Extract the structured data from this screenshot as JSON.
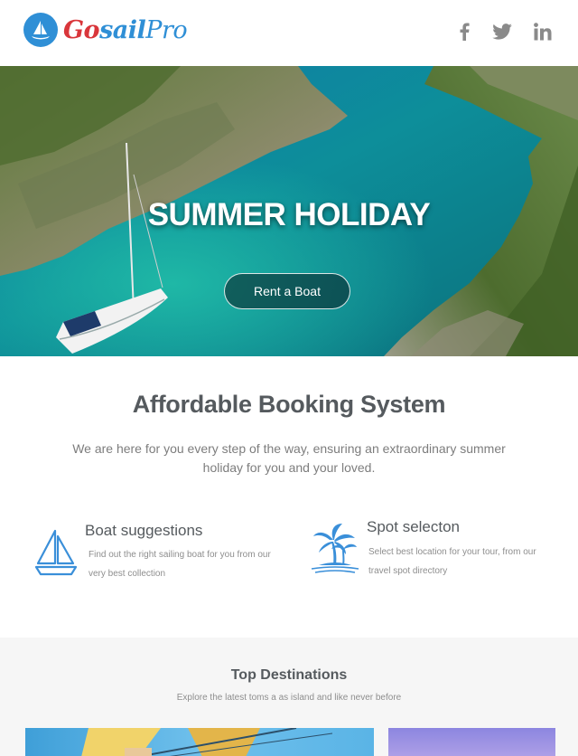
{
  "header": {
    "logo": {
      "part1": "Go",
      "part2": "sail",
      "part3": "Pro"
    },
    "social": [
      "facebook-icon",
      "twitter-icon",
      "linkedin-icon"
    ]
  },
  "hero": {
    "title": "SUMMER HOLIDAY",
    "button_label": "Rent a Boat"
  },
  "intro": {
    "title": "Affordable Booking System",
    "text": "We are here for you every step of the way, ensuring an extraordinary summer holiday for you and your loved."
  },
  "features": [
    {
      "icon": "sailboat-icon",
      "title": "Boat suggestions",
      "desc": "Find out  the right sailing boat for you from our very best collection"
    },
    {
      "icon": "palm-island-icon",
      "title": "Spot selecton",
      "desc": "Select best location for your tour, from our travel spot directory"
    }
  ],
  "destinations": {
    "title": "Top Destinations",
    "subtitle": "Explore the latest toms a as island and like never before"
  },
  "colors": {
    "brand_blue": "#2f8fd6",
    "brand_red": "#d9363b",
    "icon_blue": "#3a8fd9"
  }
}
